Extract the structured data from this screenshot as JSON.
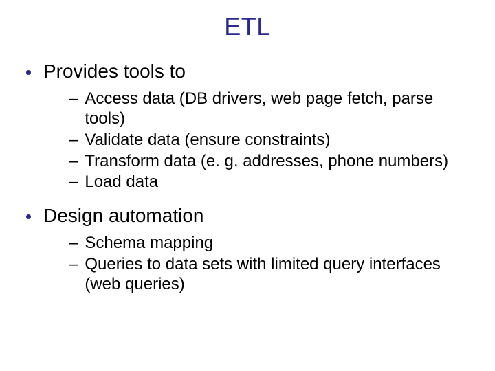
{
  "title": "ETL",
  "sections": [
    {
      "heading": "Provides tools to",
      "items": [
        "Access data (DB drivers, web page fetch, parse tools)",
        "Validate data (ensure constraints)",
        "Transform data (e. g. addresses, phone numbers)",
        "Load data"
      ]
    },
    {
      "heading": "Design automation",
      "items": [
        "Schema mapping",
        "Queries to data sets with limited query interfaces (web queries)"
      ]
    }
  ]
}
